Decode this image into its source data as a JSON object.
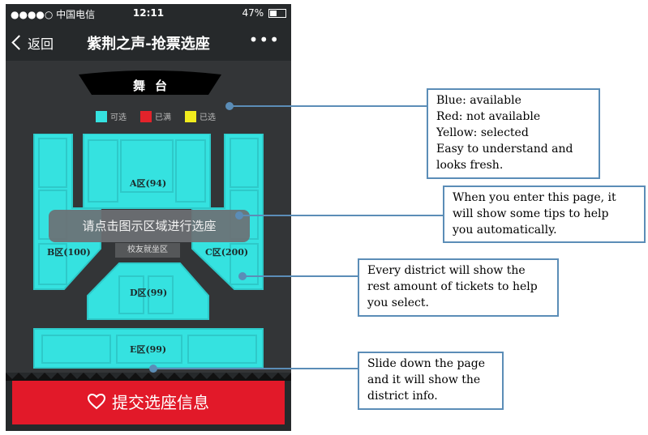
{
  "status_bar": {
    "carrier": "●●●●○ 中国电信",
    "time": "12:11",
    "battery": "47%"
  },
  "nav": {
    "back_label": "返回",
    "title": "紫荆之声-抢票选座",
    "more_label": "•••"
  },
  "stage": {
    "label": "舞台"
  },
  "legend": [
    {
      "label": "可选",
      "color": "#35e2e0"
    },
    {
      "label": "已满",
      "color": "#e3232b"
    },
    {
      "label": "已选",
      "color": "#f1ec1e"
    }
  ],
  "districts": [
    {
      "id": "A",
      "label": "A区(94)"
    },
    {
      "id": "B",
      "label": "B区(100)"
    },
    {
      "id": "C",
      "label": "C区(200)"
    },
    {
      "id": "D",
      "label": "D区(99)"
    },
    {
      "id": "E",
      "label": "E区(99)"
    }
  ],
  "alumni_area": "校友就坐区",
  "tip": "请点击图示区域进行选座",
  "submit_label": "提交选座信息",
  "annotations": [
    {
      "lines": [
        "Blue: available",
        "Red: not available",
        "Yellow: selected",
        "Easy to understand and",
        "looks fresh."
      ]
    },
    {
      "lines": [
        "When you enter this page, it",
        "will show some tips to help",
        "you automatically."
      ]
    },
    {
      "lines": [
        "Every district will show the",
        "rest amount of tickets to help",
        "you select."
      ]
    },
    {
      "lines": [
        "Slide down the page",
        "and it will show the",
        "district info."
      ]
    }
  ],
  "colors": {
    "available": "#35e2e0",
    "border": "#2ec9c9",
    "full": "#e3232b",
    "selected": "#f1ec1e",
    "accent": "#e21929",
    "annotation_border": "#5b8db7"
  }
}
